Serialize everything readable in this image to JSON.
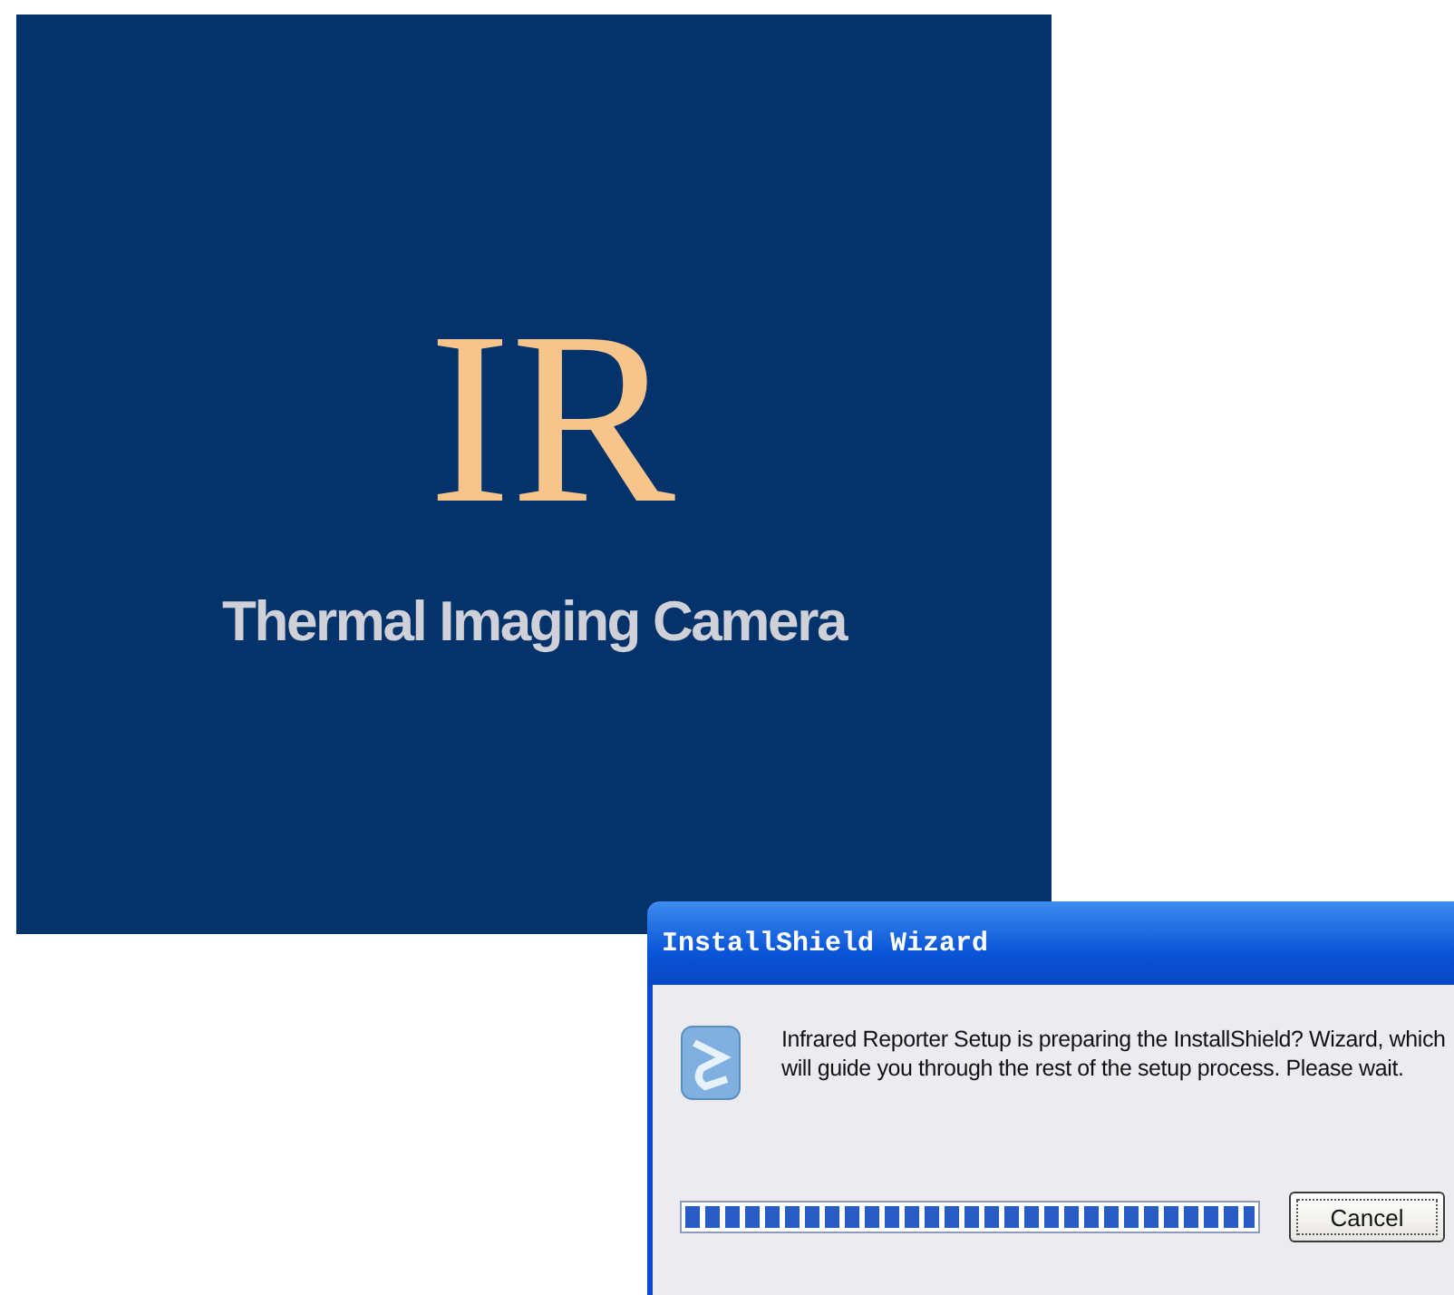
{
  "splash": {
    "logo": "IR",
    "subtitle": "Thermal Imaging Camera"
  },
  "dialog": {
    "title": "InstallShield Wizard",
    "message": "Infrared Reporter Setup is preparing the InstallShield? Wizard, which will guide you through the rest of the setup process. Please wait.",
    "progress": {
      "level": 1
    },
    "buttons": [
      "Cancel"
    ]
  }
}
